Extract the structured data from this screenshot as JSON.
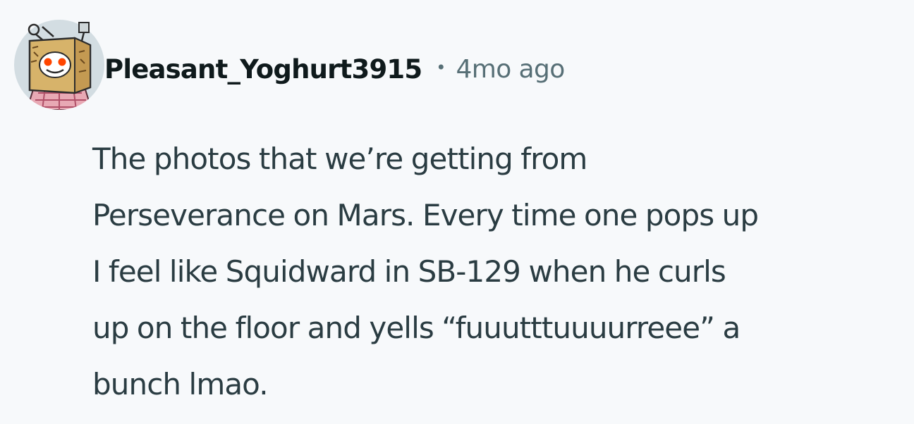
{
  "comment": {
    "author": "Pleasant_Yoghurt3915",
    "separator": "•",
    "timestamp": "4mo ago",
    "avatar_icon": "snoo-box-head-avatar",
    "body_lines": [
      "The photos that we’re getting from",
      "Perseverance on Mars. Every time one pops up",
      "I feel like Squidward in SB-129 when he curls",
      "up on the floor and yells “fuuutttuuuurreee” a",
      "bunch lmao."
    ]
  },
  "colors": {
    "background": "#f7f9fb",
    "author": "#0f1a1c",
    "meta": "#576f76",
    "body": "#2a3c42",
    "avatar_bg": "#d3dde2"
  }
}
